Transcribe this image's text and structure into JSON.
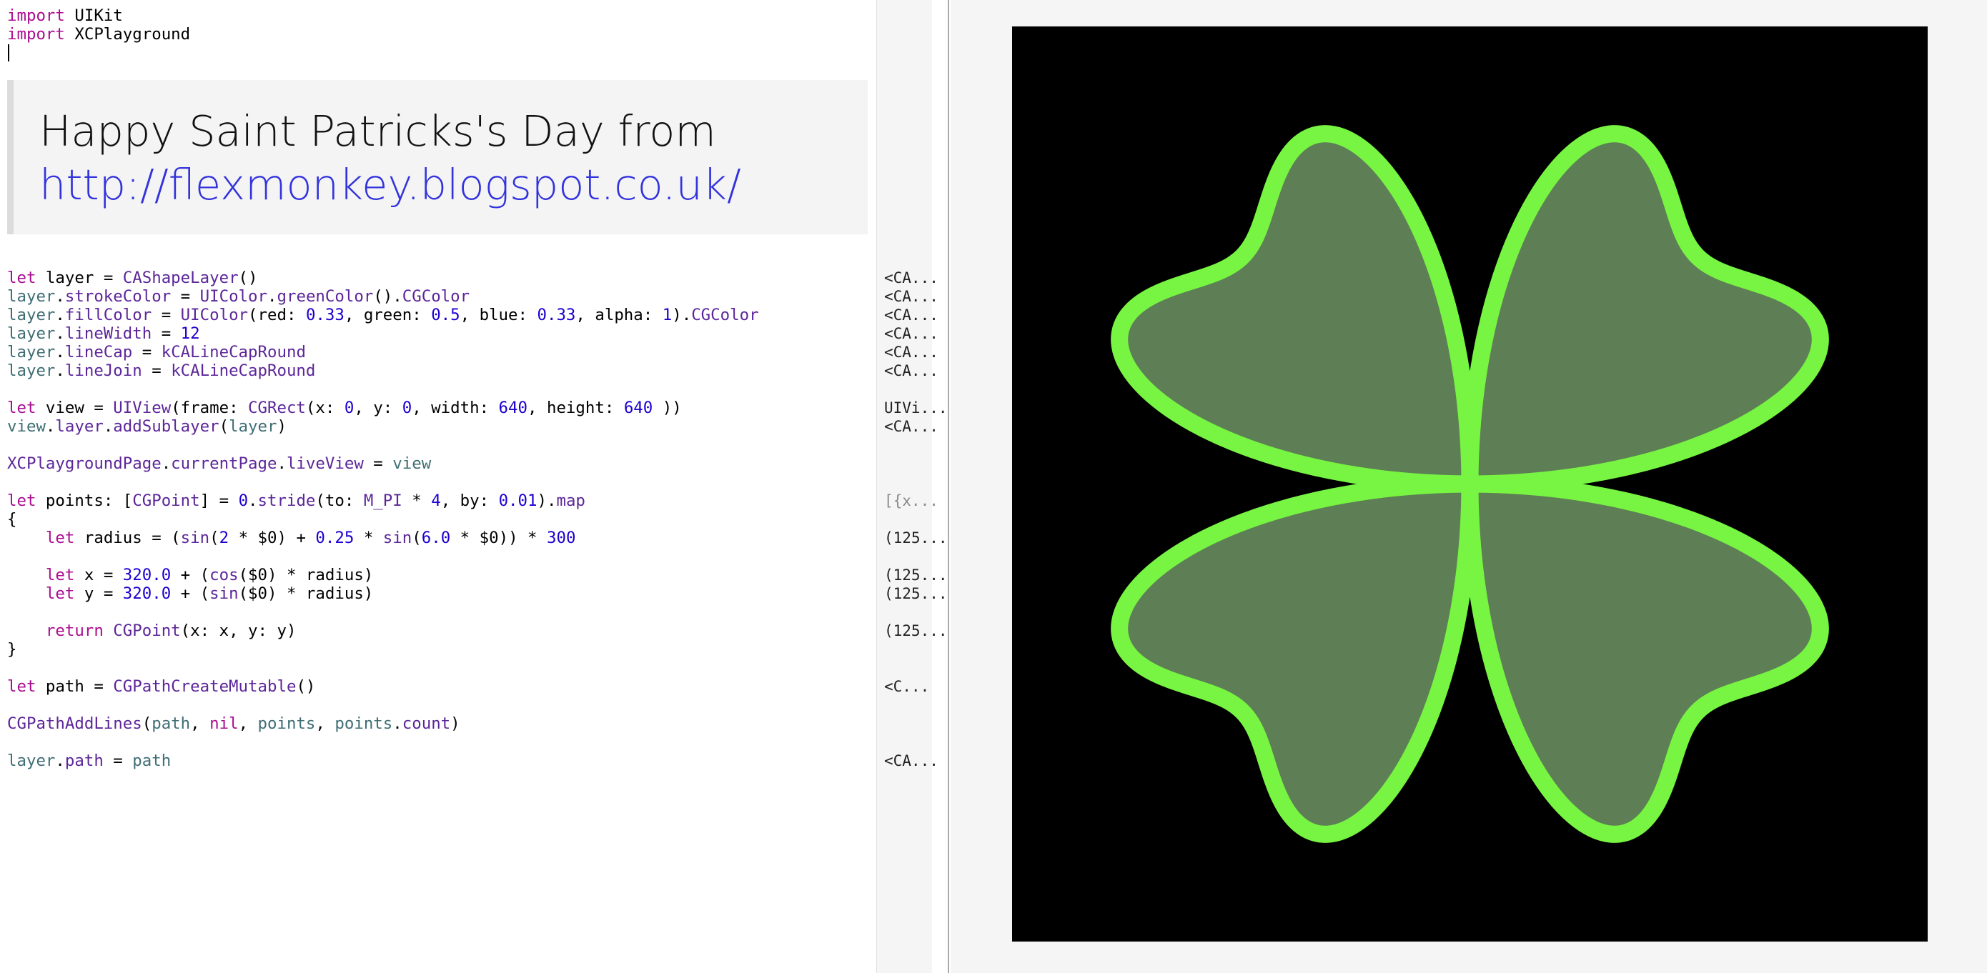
{
  "editor": {
    "header_lines": [
      [
        {
          "t": "import",
          "c": "kw"
        },
        {
          "t": " UIKit"
        }
      ],
      [
        {
          "t": "import",
          "c": "kw"
        },
        {
          "t": " XCPlayground"
        }
      ]
    ],
    "markdown": {
      "title": "Happy Saint Patricks's Day from",
      "link": "http://flexmonkey.blogspot.co.uk/"
    },
    "code_lines": [
      [
        {
          "t": "let",
          "c": "kw"
        },
        {
          "t": " layer = "
        },
        {
          "t": "CAShapeLayer",
          "c": "ty"
        },
        {
          "t": "()"
        }
      ],
      [
        {
          "t": "layer",
          "c": "pr"
        },
        {
          "t": "."
        },
        {
          "t": "strokeColor",
          "c": "ty"
        },
        {
          "t": " = "
        },
        {
          "t": "UIColor",
          "c": "ty"
        },
        {
          "t": "."
        },
        {
          "t": "greenColor",
          "c": "ty"
        },
        {
          "t": "()."
        },
        {
          "t": "CGColor",
          "c": "ty"
        }
      ],
      [
        {
          "t": "layer",
          "c": "pr"
        },
        {
          "t": "."
        },
        {
          "t": "fillColor",
          "c": "ty"
        },
        {
          "t": " = "
        },
        {
          "t": "UIColor",
          "c": "ty"
        },
        {
          "t": "(red: "
        },
        {
          "t": "0.33",
          "c": "num"
        },
        {
          "t": ", green: "
        },
        {
          "t": "0.5",
          "c": "num"
        },
        {
          "t": ", blue: "
        },
        {
          "t": "0.33",
          "c": "num"
        },
        {
          "t": ", alpha: "
        },
        {
          "t": "1",
          "c": "num"
        },
        {
          "t": ")."
        },
        {
          "t": "CGColor",
          "c": "ty"
        }
      ],
      [
        {
          "t": "layer",
          "c": "pr"
        },
        {
          "t": "."
        },
        {
          "t": "lineWidth",
          "c": "ty"
        },
        {
          "t": " = "
        },
        {
          "t": "12",
          "c": "num"
        }
      ],
      [
        {
          "t": "layer",
          "c": "pr"
        },
        {
          "t": "."
        },
        {
          "t": "lineCap",
          "c": "ty"
        },
        {
          "t": " = "
        },
        {
          "t": "kCALineCapRound",
          "c": "ty"
        }
      ],
      [
        {
          "t": "layer",
          "c": "pr"
        },
        {
          "t": "."
        },
        {
          "t": "lineJoin",
          "c": "ty"
        },
        {
          "t": " = "
        },
        {
          "t": "kCALineCapRound",
          "c": "ty"
        }
      ],
      [],
      [
        {
          "t": "let",
          "c": "kw"
        },
        {
          "t": " view = "
        },
        {
          "t": "UIView",
          "c": "ty"
        },
        {
          "t": "(frame: "
        },
        {
          "t": "CGRect",
          "c": "ty"
        },
        {
          "t": "(x: "
        },
        {
          "t": "0",
          "c": "num"
        },
        {
          "t": ", y: "
        },
        {
          "t": "0",
          "c": "num"
        },
        {
          "t": ", width: "
        },
        {
          "t": "640",
          "c": "num"
        },
        {
          "t": ", height: "
        },
        {
          "t": "640",
          "c": "num"
        },
        {
          "t": " ))"
        }
      ],
      [
        {
          "t": "view",
          "c": "pr"
        },
        {
          "t": "."
        },
        {
          "t": "layer",
          "c": "ty"
        },
        {
          "t": "."
        },
        {
          "t": "addSublayer",
          "c": "ty"
        },
        {
          "t": "("
        },
        {
          "t": "layer",
          "c": "pr"
        },
        {
          "t": ")"
        }
      ],
      [],
      [
        {
          "t": "XCPlaygroundPage",
          "c": "ty"
        },
        {
          "t": "."
        },
        {
          "t": "currentPage",
          "c": "ty"
        },
        {
          "t": "."
        },
        {
          "t": "liveView",
          "c": "ty"
        },
        {
          "t": " = "
        },
        {
          "t": "view",
          "c": "pr"
        }
      ],
      [],
      [
        {
          "t": "let",
          "c": "kw"
        },
        {
          "t": " points: ["
        },
        {
          "t": "CGPoint",
          "c": "ty"
        },
        {
          "t": "] = "
        },
        {
          "t": "0",
          "c": "num"
        },
        {
          "t": "."
        },
        {
          "t": "stride",
          "c": "ty"
        },
        {
          "t": "(to: "
        },
        {
          "t": "M_PI",
          "c": "ty"
        },
        {
          "t": " * "
        },
        {
          "t": "4",
          "c": "num"
        },
        {
          "t": ", by: "
        },
        {
          "t": "0.01",
          "c": "num"
        },
        {
          "t": ")."
        },
        {
          "t": "map",
          "c": "ty"
        }
      ],
      [
        {
          "t": "{"
        }
      ],
      [
        {
          "t": "    "
        },
        {
          "t": "let",
          "c": "kw"
        },
        {
          "t": " radius = ("
        },
        {
          "t": "sin",
          "c": "ty"
        },
        {
          "t": "("
        },
        {
          "t": "2",
          "c": "num"
        },
        {
          "t": " * $0) + "
        },
        {
          "t": "0.25",
          "c": "num"
        },
        {
          "t": " * "
        },
        {
          "t": "sin",
          "c": "ty"
        },
        {
          "t": "("
        },
        {
          "t": "6.0",
          "c": "num"
        },
        {
          "t": " * $0)) * "
        },
        {
          "t": "300",
          "c": "num"
        }
      ],
      [],
      [
        {
          "t": "    "
        },
        {
          "t": "let",
          "c": "kw"
        },
        {
          "t": " x = "
        },
        {
          "t": "320.0",
          "c": "num"
        },
        {
          "t": " + ("
        },
        {
          "t": "cos",
          "c": "ty"
        },
        {
          "t": "($0) * radius)"
        }
      ],
      [
        {
          "t": "    "
        },
        {
          "t": "let",
          "c": "kw"
        },
        {
          "t": " y = "
        },
        {
          "t": "320.0",
          "c": "num"
        },
        {
          "t": " + ("
        },
        {
          "t": "sin",
          "c": "ty"
        },
        {
          "t": "($0) * radius)"
        }
      ],
      [],
      [
        {
          "t": "    "
        },
        {
          "t": "return",
          "c": "kw"
        },
        {
          "t": " "
        },
        {
          "t": "CGPoint",
          "c": "ty"
        },
        {
          "t": "(x: x, y: y)"
        }
      ],
      [
        {
          "t": "}"
        }
      ],
      [],
      [
        {
          "t": "let",
          "c": "kw"
        },
        {
          "t": " path = "
        },
        {
          "t": "CGPathCreateMutable",
          "c": "ty"
        },
        {
          "t": "()"
        }
      ],
      [],
      [
        {
          "t": "CGPathAddLines",
          "c": "ty"
        },
        {
          "t": "("
        },
        {
          "t": "path",
          "c": "pr"
        },
        {
          "t": ", "
        },
        {
          "t": "nil",
          "c": "kw"
        },
        {
          "t": ", "
        },
        {
          "t": "points",
          "c": "pr"
        },
        {
          "t": ", "
        },
        {
          "t": "points",
          "c": "pr"
        },
        {
          "t": "."
        },
        {
          "t": "count",
          "c": "ty"
        },
        {
          "t": ")"
        }
      ],
      [],
      [
        {
          "t": "layer",
          "c": "pr"
        },
        {
          "t": "."
        },
        {
          "t": "path",
          "c": "ty"
        },
        {
          "t": " = "
        },
        {
          "t": "path",
          "c": "pr"
        }
      ]
    ]
  },
  "results": [
    "<CA...",
    "<CA...",
    "<CA...",
    "<CA...",
    "<CA...",
    "<CA...",
    "",
    "UIVi...",
    "<CA...",
    "",
    "",
    "",
    "[{x...",
    "",
    "(125...",
    "",
    "(125...",
    "(125...",
    "",
    "(125...",
    "",
    "",
    "<C...",
    "",
    "",
    "",
    "<CA..."
  ],
  "live_view": {
    "background": "#000000",
    "stroke_color": "#77f542",
    "fill_color": "#5e7f55",
    "line_width": 12,
    "view_size": 640,
    "clover": {
      "center": 320.0,
      "scale": 300,
      "petal_freq": 2,
      "ripple_amp": 0.25,
      "ripple_freq": 6.0,
      "turns": 4,
      "step": 0.01
    }
  }
}
